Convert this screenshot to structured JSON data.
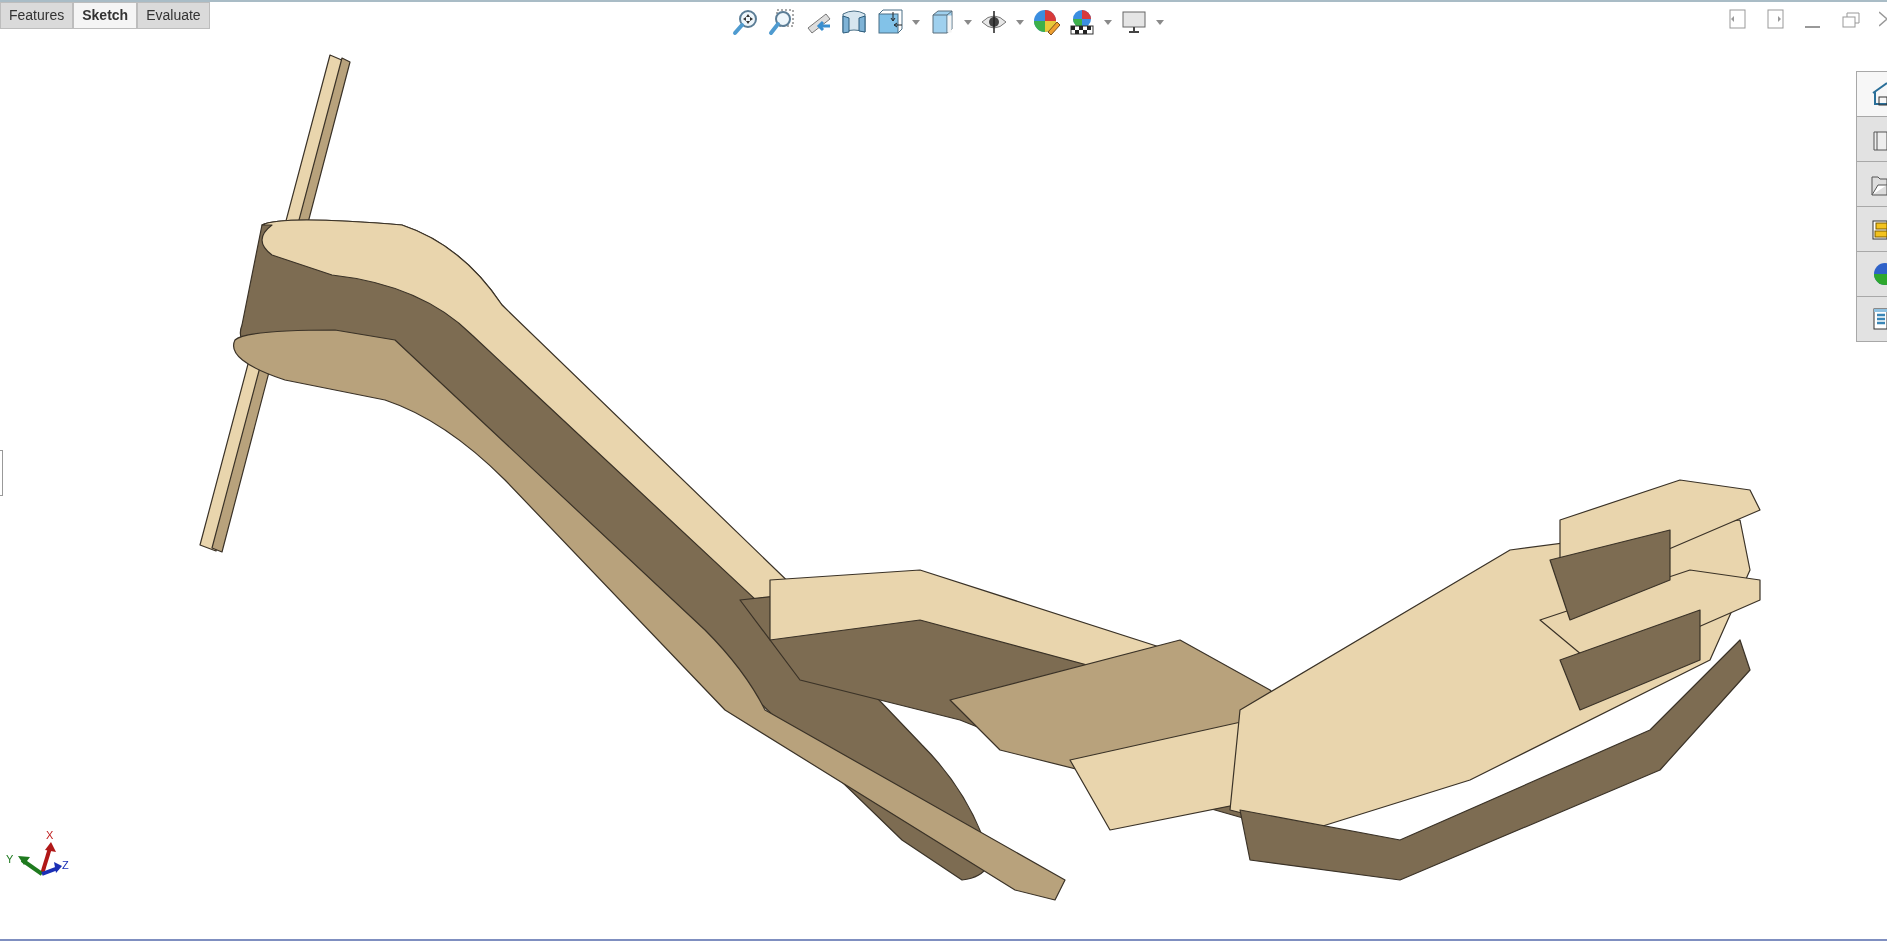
{
  "command_tabs": [
    {
      "label": "Features",
      "selected": false
    },
    {
      "label": "Sketch",
      "selected": true
    },
    {
      "label": "Evaluate",
      "selected": false
    }
  ],
  "triad": {
    "x_label": "X",
    "y_label": "Y",
    "z_label": "Z"
  }
}
